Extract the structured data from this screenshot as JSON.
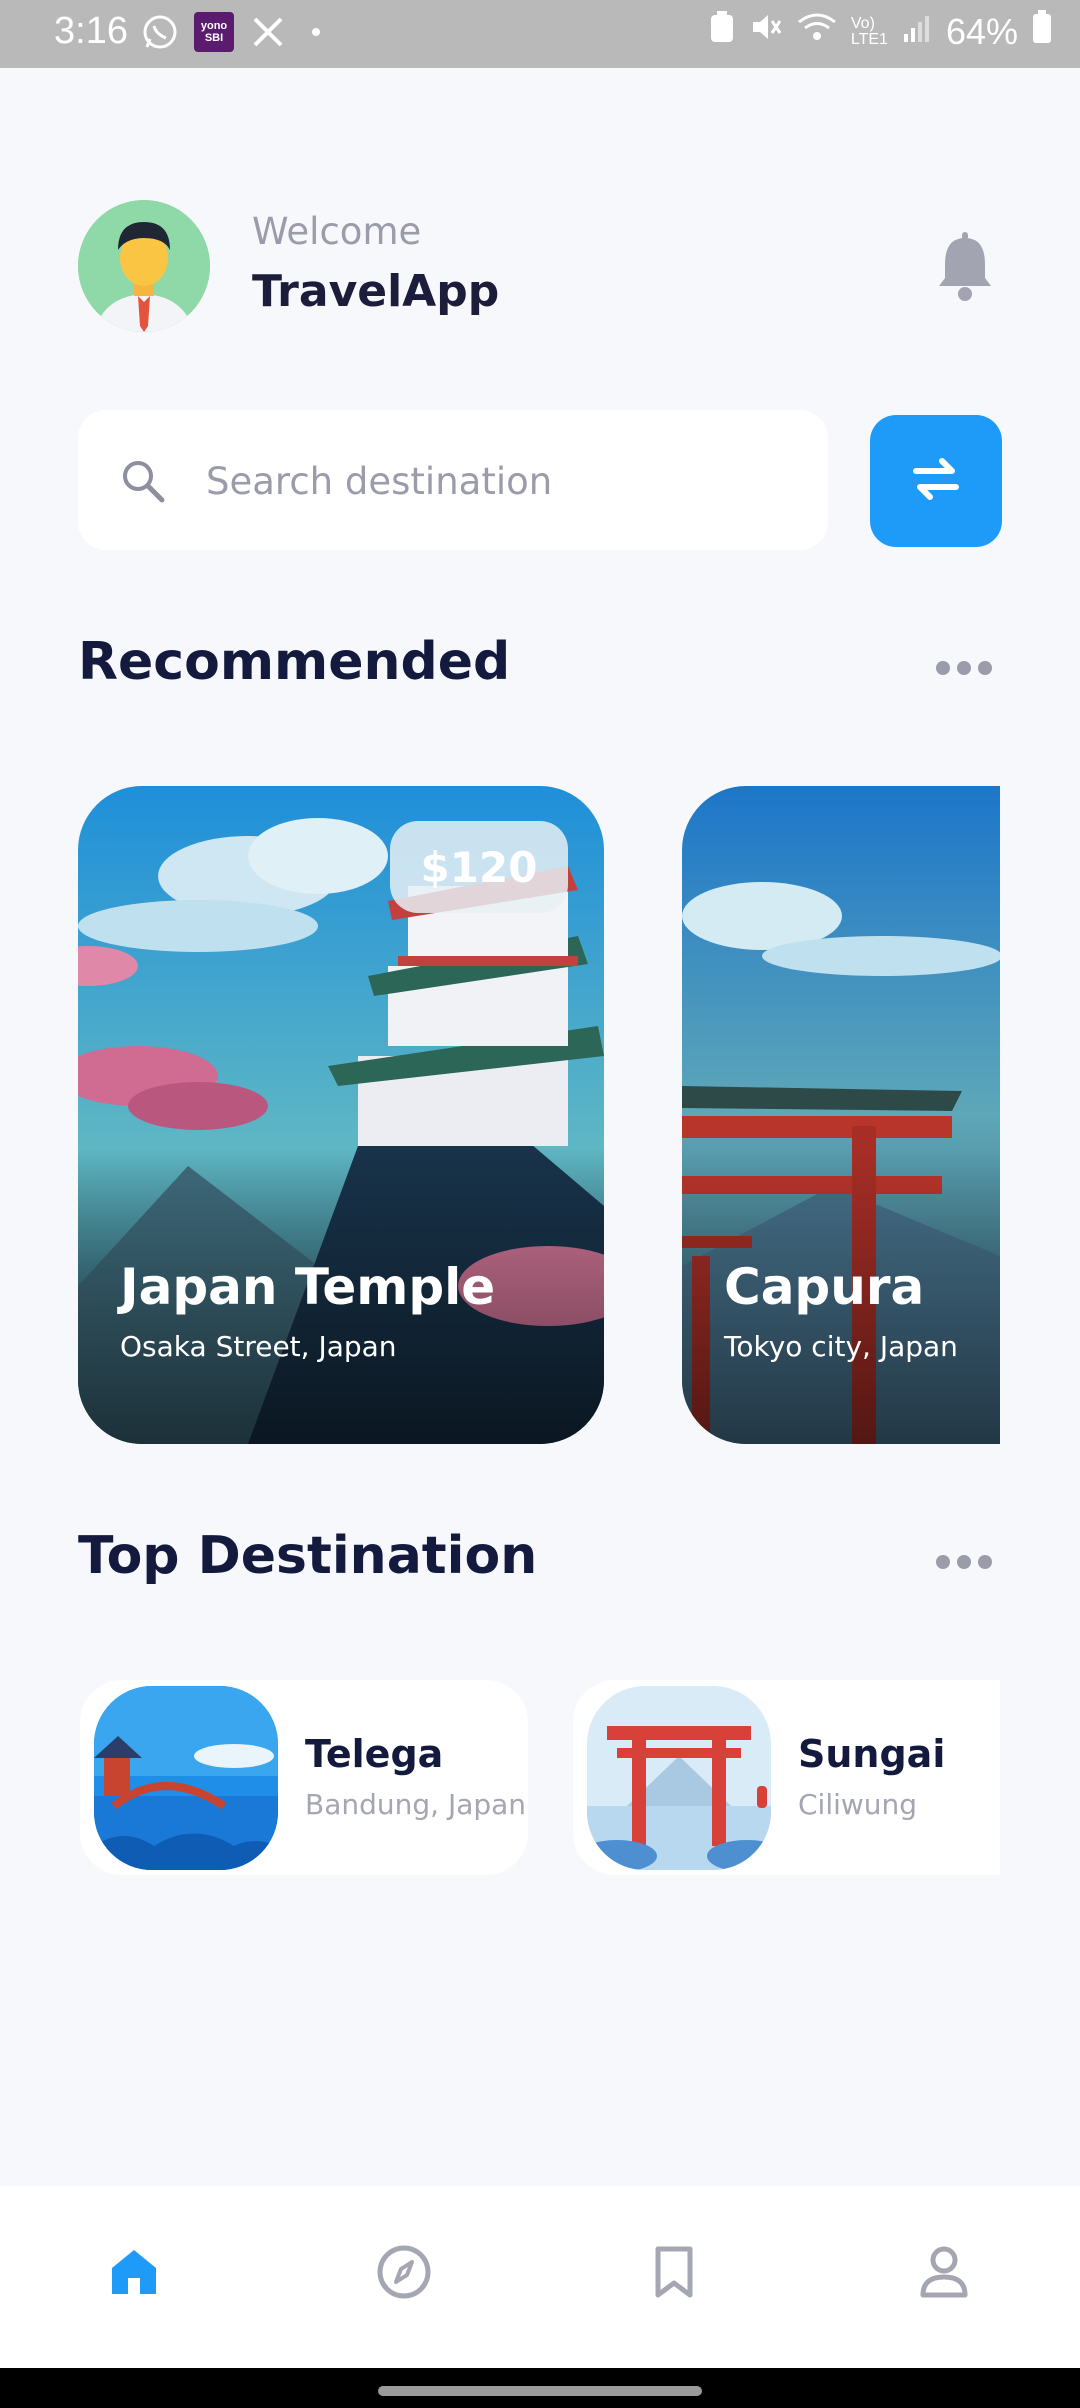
{
  "status_bar": {
    "time": "3:16",
    "battery": "64%",
    "icons": [
      "whatsapp-icon",
      "yono-sbi-icon",
      "x-icon",
      "dot-icon",
      "battery-saver-icon",
      "mute-icon",
      "wifi-icon",
      "volte-icon",
      "signal-icon",
      "battery-icon"
    ],
    "yono_label": "yono SBI"
  },
  "header": {
    "welcome": "Welcome",
    "app_name": "TravelApp",
    "bell_icon": "bell-icon"
  },
  "search": {
    "placeholder": "Search destination",
    "value": "",
    "icon": "search-icon",
    "swap_icon": "swap-arrows-icon"
  },
  "recommended": {
    "title": "Recommended",
    "cards": [
      {
        "title": "Japan Temple",
        "subtitle": "Osaka Street, Japan",
        "price": "$120"
      },
      {
        "title": "Capura",
        "subtitle": "Tokyo city, Japan"
      }
    ]
  },
  "top_destination": {
    "title": "Top Destination",
    "items": [
      {
        "name": "Telega",
        "location": "Bandung, Japan"
      },
      {
        "name": "Sungai",
        "location": "Ciliwung"
      }
    ]
  },
  "nav": {
    "items": [
      "home-icon",
      "compass-icon",
      "bookmark-icon",
      "profile-icon"
    ],
    "active": "home-icon"
  },
  "colors": {
    "accent": "#1e9bf8",
    "background": "#f6f8fb",
    "title_text": "#141a3d",
    "muted_text": "#9a9caa"
  }
}
